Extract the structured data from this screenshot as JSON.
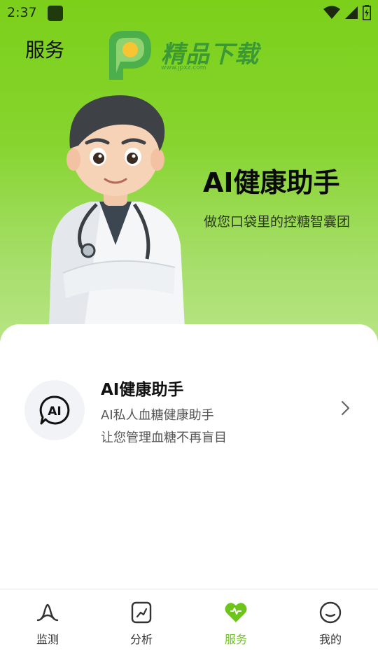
{
  "status_bar": {
    "time": "2:37"
  },
  "header": {
    "title": "服务"
  },
  "watermark": {
    "text": "精品下载",
    "url": "www.jpxz.com"
  },
  "hero": {
    "title": "AI健康助手",
    "subtitle": "做您口袋里的控糖智囊团"
  },
  "services": [
    {
      "icon": "ai-chat-icon",
      "icon_text": "AI",
      "title": "AI健康助手",
      "desc_line1": "AI私人血糖健康助手",
      "desc_line2": "让您管理血糖不再盲目"
    }
  ],
  "bottom_nav": {
    "items": [
      {
        "label": "监测",
        "icon": "monitor-icon",
        "active": false
      },
      {
        "label": "分析",
        "icon": "analysis-icon",
        "active": false
      },
      {
        "label": "服务",
        "icon": "heart-icon",
        "active": true
      },
      {
        "label": "我的",
        "icon": "profile-icon",
        "active": false
      }
    ]
  },
  "colors": {
    "accent": "#6cc51b",
    "hero_top": "#7cd01a",
    "hero_bottom": "#b9e587"
  }
}
